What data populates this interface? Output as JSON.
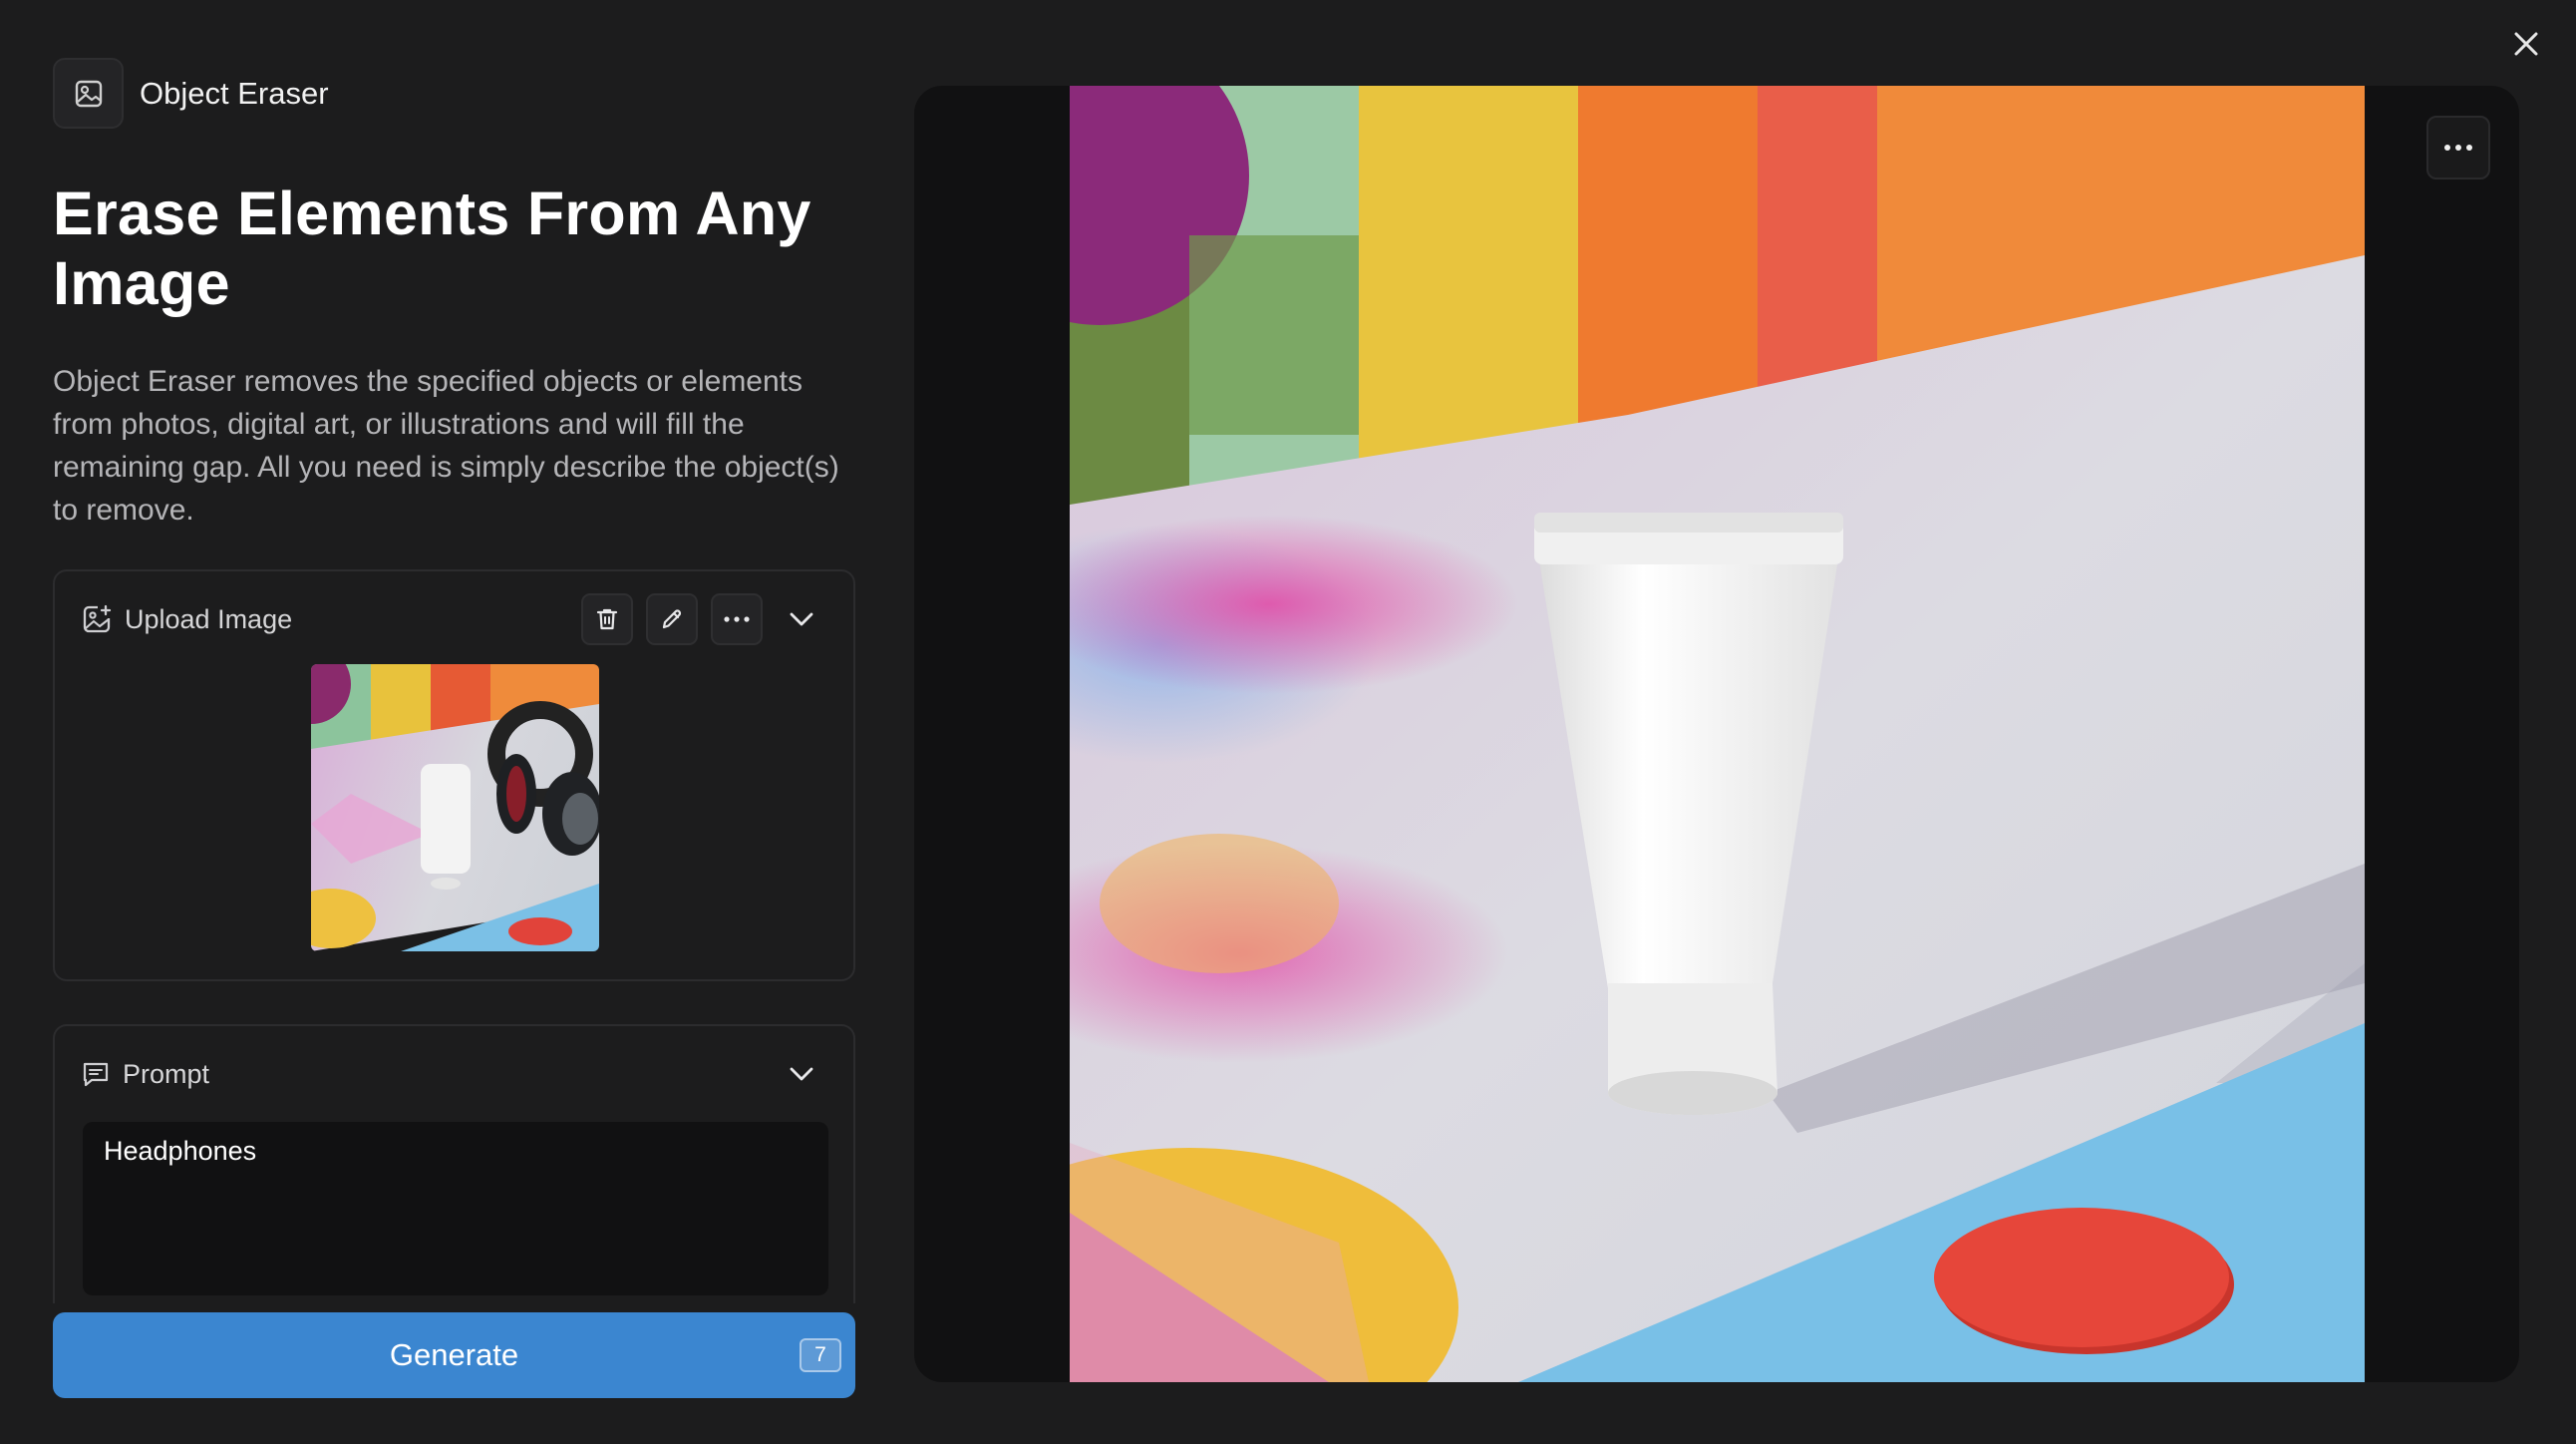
{
  "app": {
    "name": "Object Eraser",
    "icon": "image-icon"
  },
  "hero": {
    "title": "Erase Elements From Any Image",
    "description": "Object Eraser removes the specified objects or elements from photos, digital art, or illustrations and will fill the remaining gap. All you need is simply describe the object(s) to remove."
  },
  "upload": {
    "title": "Upload Image",
    "icon": "image-add-icon",
    "actions": [
      "trash-icon",
      "pencil-icon",
      "more-horizontal-icon",
      "chevron-down-icon"
    ]
  },
  "prompt": {
    "title": "Prompt",
    "icon": "message-icon",
    "value": "Headphones"
  },
  "generate": {
    "label": "Generate",
    "credits": "7"
  },
  "colors": {
    "background": "#1c1c1d",
    "accent": "#3b86d0",
    "preview_bg": "#111112"
  }
}
